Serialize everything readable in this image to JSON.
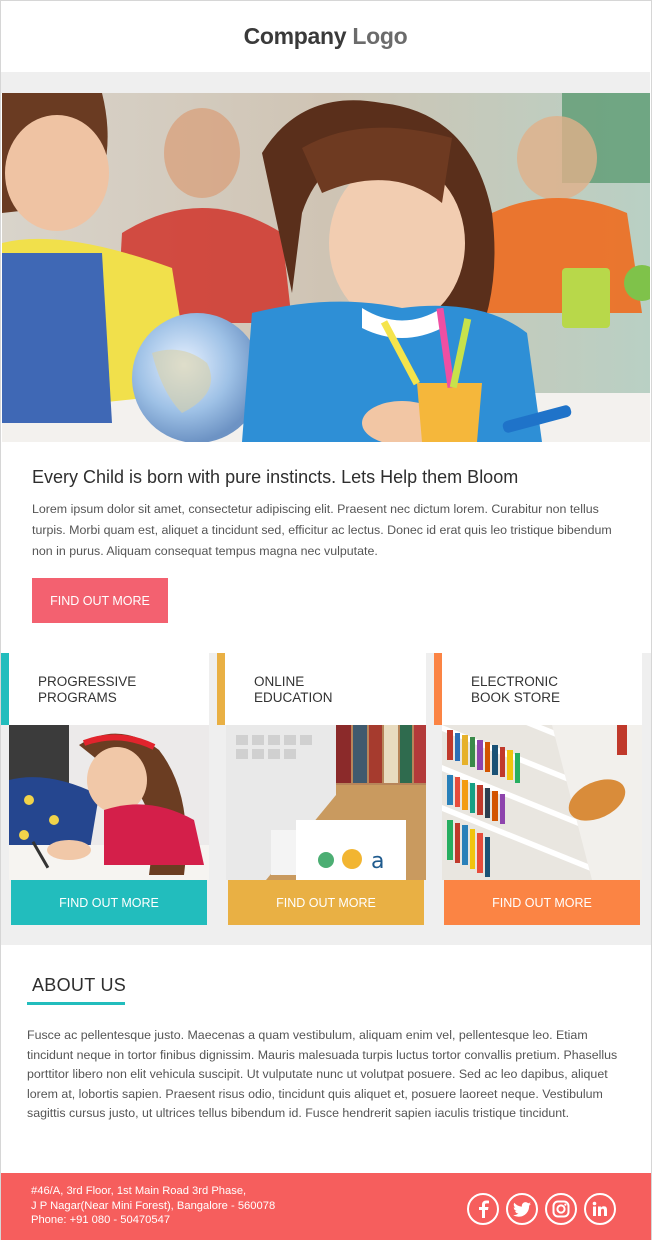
{
  "header": {
    "logo_part1": "Company",
    "logo_part2": "Logo"
  },
  "hero": {
    "image": "children-drawing-classroom-photo"
  },
  "intro": {
    "title": "Every Child is born with pure instincts. Lets Help them Bloom",
    "text": "Lorem ipsum dolor sit amet, consectetur adipiscing elit. Praesent nec dictum lorem. Curabitur non tellus turpis. Morbi quam est, aliquet a tincidunt sed, efficitur ac lectus. Donec id erat quis leo tristique bibendum non in purus. Aliquam consequat tempus magna nec vulputate.",
    "button": "FIND OUT MORE",
    "button_color": "#f36170"
  },
  "features": [
    {
      "title": "PROGRESSIVE\nPROGRAMS",
      "image": "girl-writing-photo",
      "button": "FIND OUT MORE",
      "color": "#22bdbd"
    },
    {
      "title": "ONLINE\nEDUCATION",
      "image": "laptop-books-photo",
      "button": "FIND OUT MORE",
      "color": "#e9b044"
    },
    {
      "title": "ELECTRONIC\nBOOK STORE",
      "image": "bookshelf-photo",
      "button": "FIND OUT MORE",
      "color": "#fb8444"
    }
  ],
  "about": {
    "title": "ABOUT US",
    "text": "Fusce ac pellentesque justo. Maecenas a quam vestibulum, aliquam enim vel, pellentesque leo. Etiam tincidunt neque in tortor finibus dignissim. Mauris malesuada turpis luctus tortor convallis pretium. Phasellus porttitor libero non elit vehicula suscipit. Ut vulputate nunc ut volutpat posuere. Sed ac leo dapibus, aliquet lorem at, lobortis sapien. Praesent risus odio, tincidunt quis aliquet et, posuere laoreet neque. Vestibulum sagittis cursus justo, ut ultrices tellus bibendum id. Fusce hendrerit sapien iaculis tristique tincidunt.",
    "accent": "#22bdbd"
  },
  "footer": {
    "address_line1": "#46/A, 3rd Floor, 1st Main Road 3rd Phase,",
    "address_line2": "J P Nagar(Near Mini Forest), Bangalore - 560078",
    "phone": "Phone: +91 080 - 50470547",
    "background": "#f65e5d",
    "socials": [
      "facebook-icon",
      "twitter-icon",
      "instagram-icon",
      "linkedin-icon"
    ]
  }
}
